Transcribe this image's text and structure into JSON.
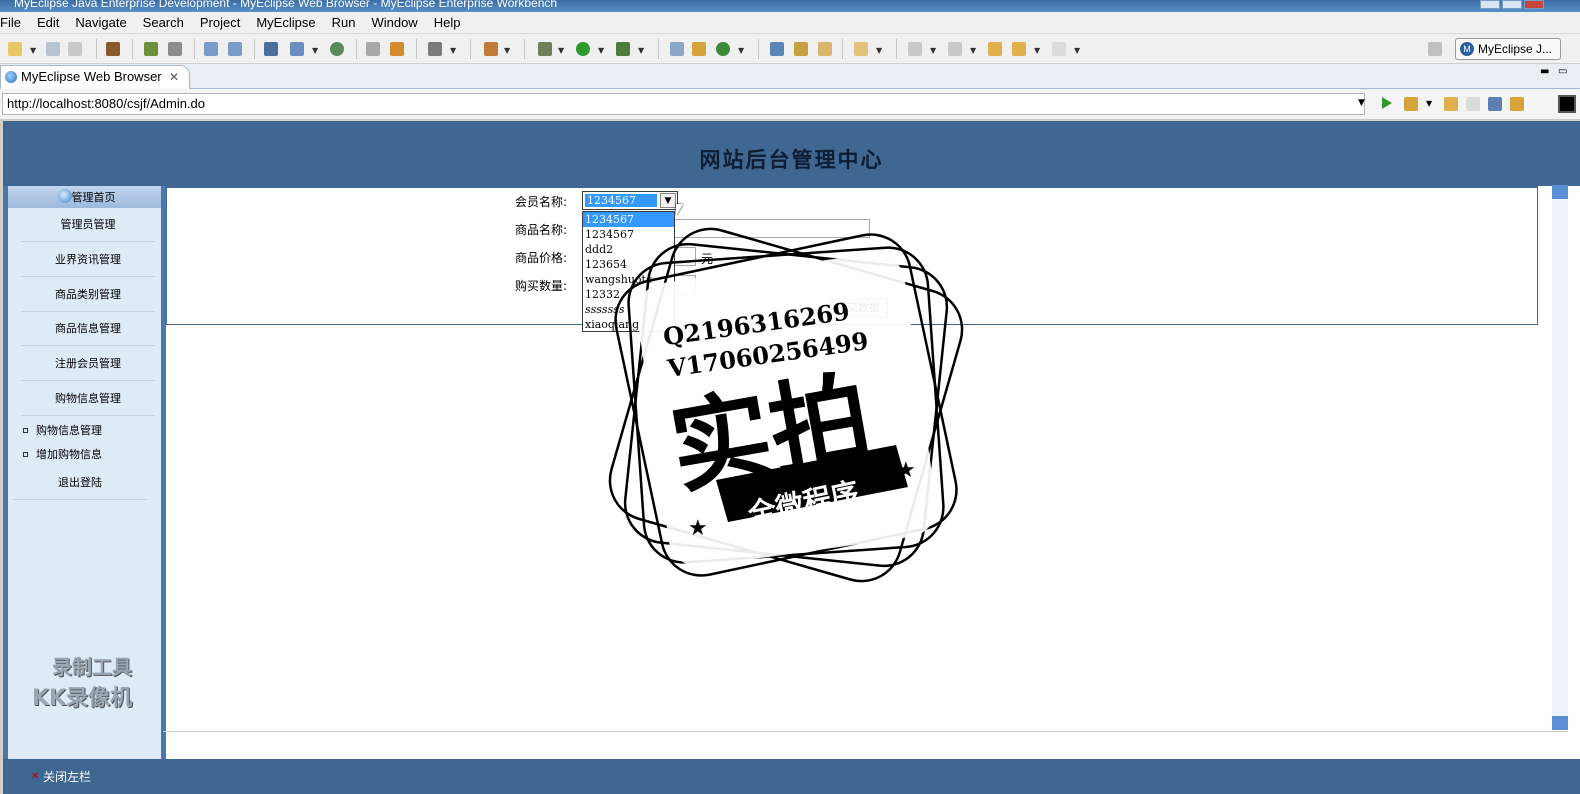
{
  "window": {
    "title": "MyEclipse Java Enterprise Development - MyEclipse Web Browser - MyEclipse Enterprise Workbench"
  },
  "menu": [
    "File",
    "Edit",
    "Navigate",
    "Search",
    "Project",
    "MyEclipse",
    "Run",
    "Window",
    "Help"
  ],
  "toolbar": {
    "perspective_label": "MyEclipse J..."
  },
  "editor_tab": {
    "label": "MyEclipse Web Browser",
    "close": "✕"
  },
  "browser": {
    "url": "http://localhost:8080/csjf/Admin.do"
  },
  "page": {
    "header_title": "网站后台管理中心",
    "sidebar": {
      "home": "管理首页",
      "items": [
        "管理员管理",
        "业界资讯管理",
        "商品类别管理",
        "商品信息管理",
        "注册会员管理",
        "购物信息管理"
      ],
      "sub_items": [
        "购物信息管理",
        "增加购物信息"
      ],
      "logout": "退出登陆"
    },
    "form": {
      "member_label": "会员名称:",
      "product_label": "商品名称:",
      "price_label": "商品价格:",
      "quantity_label": "购买数量:",
      "unit": "元",
      "submit": "提交数据",
      "member_selected": "1234567",
      "member_options": [
        "1234567",
        "1234567",
        "ddd2",
        "123654",
        "wangshuotc",
        "12332",
        "sssssss",
        "xiaoqiang"
      ]
    },
    "footer_close_left": "关闭左栏"
  },
  "watermarks": {
    "recorder_line1": "录制工具",
    "recorder_line2": "KK录像机",
    "stamp_q": "Q2196316269",
    "stamp_v": "V17060256499",
    "stamp_main": "实拍",
    "stamp_banner": "全微程序"
  }
}
